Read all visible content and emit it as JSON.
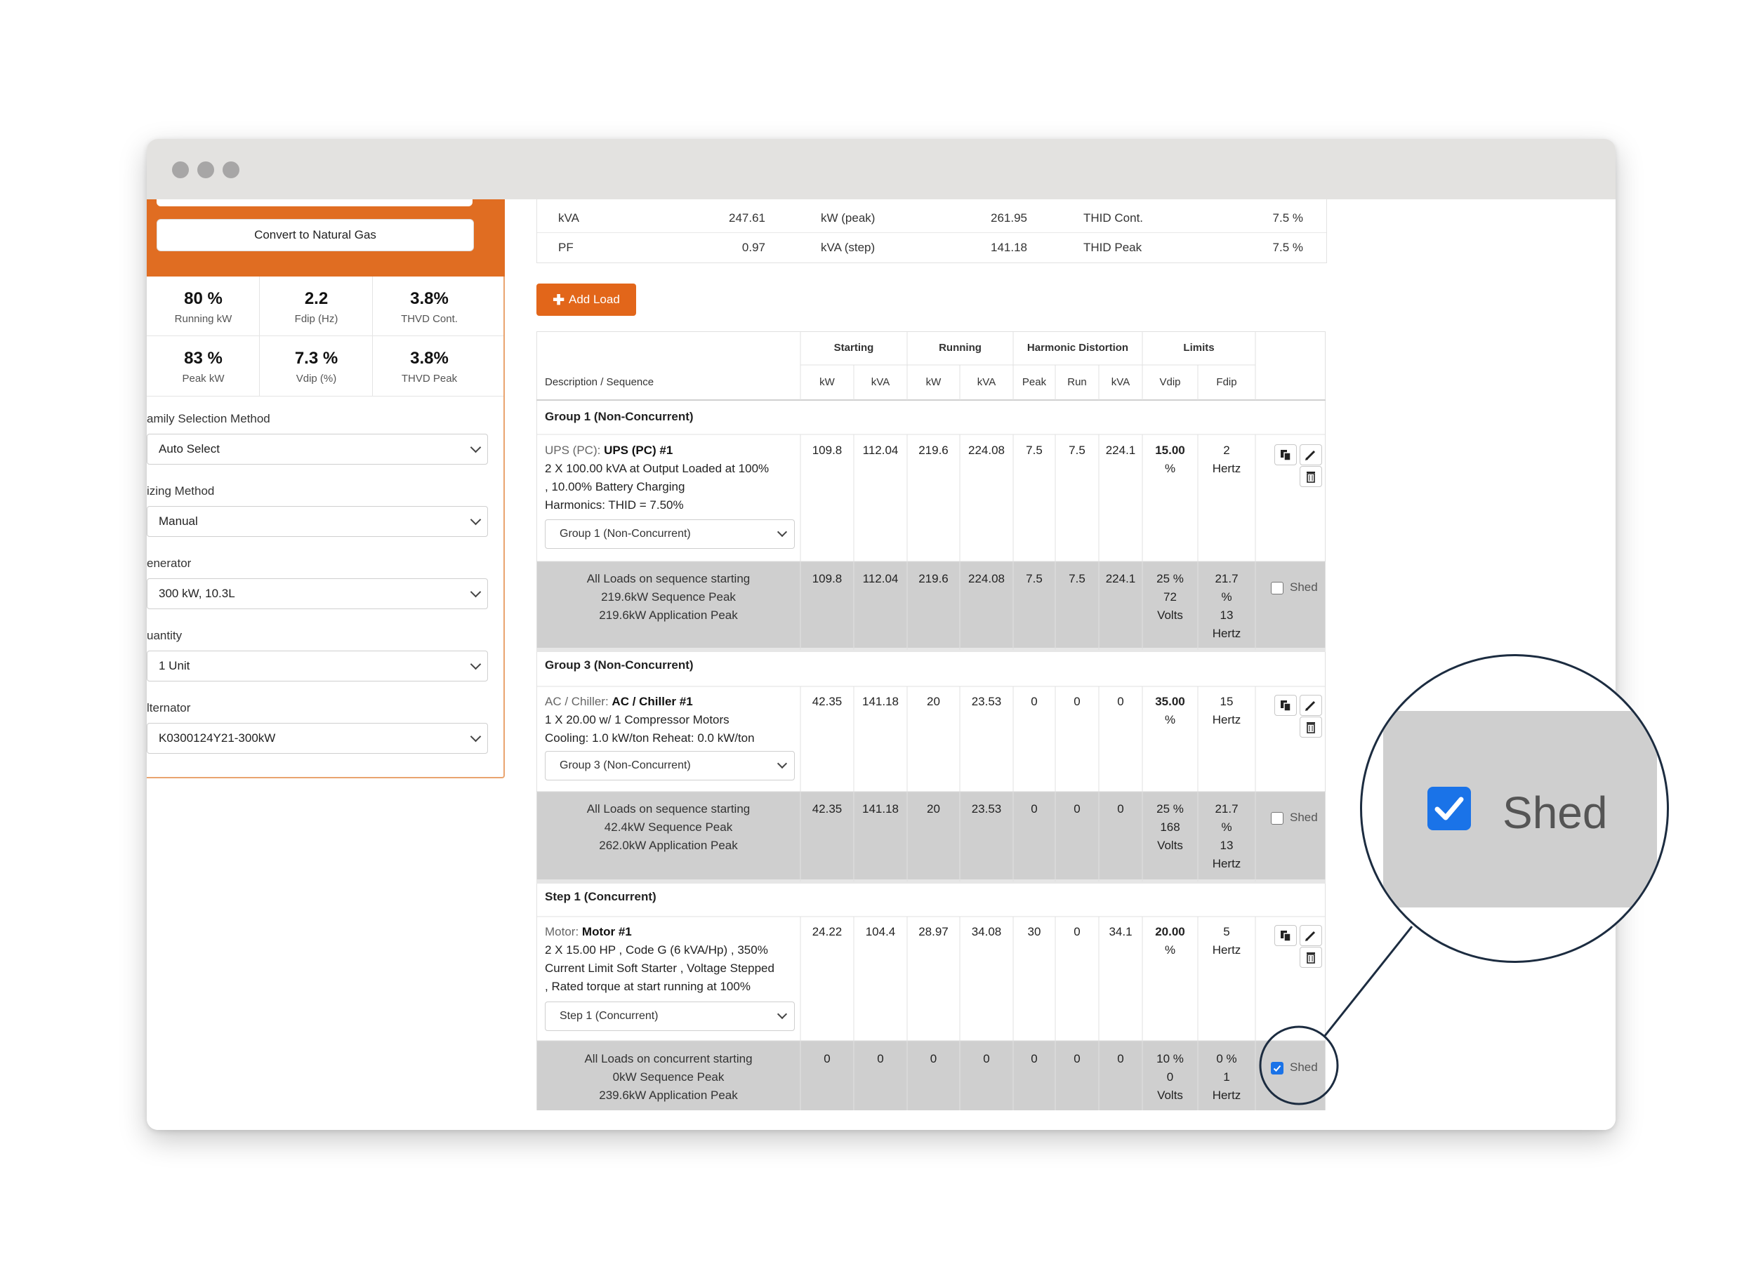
{
  "left_panel": {
    "convert_button": "Convert to Natural Gas",
    "stats": [
      {
        "value": "80 %",
        "label": "Running kW"
      },
      {
        "value": "2.2",
        "label": "Fdip (Hz)"
      },
      {
        "value": "3.8%",
        "label": "THVD Cont."
      },
      {
        "value": "83 %",
        "label": "Peak kW"
      },
      {
        "value": "7.3 %",
        "label": "Vdip (%)"
      },
      {
        "value": "3.8%",
        "label": "THVD Peak"
      }
    ],
    "fields": [
      {
        "label": "amily Selection Method",
        "value": "Auto Select"
      },
      {
        "label": "izing Method",
        "value": "Manual"
      },
      {
        "label": "enerator",
        "value": "300 kW, 10.3L"
      },
      {
        "label": "uantity",
        "value": "1 Unit"
      },
      {
        "label": "lternator",
        "value": "K0300124Y21-300kW"
      }
    ]
  },
  "summary": {
    "rows": [
      {
        "l1": "kVA",
        "v1": "247.61",
        "l2": "kW (peak)",
        "v2": "261.95",
        "l3": "THID Cont.",
        "v3": "7.5 %"
      },
      {
        "l1": "PF",
        "v1": "0.97",
        "l2": "kVA (step)",
        "v2": "141.18",
        "l3": "THID Peak",
        "v3": "7.5 %"
      }
    ]
  },
  "add_load_label": "Add Load",
  "table": {
    "header_groups": [
      "Starting",
      "Running",
      "Harmonic Distortion",
      "Limits"
    ],
    "description_header": "Description / Sequence",
    "columns": [
      "kW",
      "kVA",
      "kW",
      "kVA",
      "Peak",
      "Run",
      "kVA",
      "Vdip",
      "Fdip"
    ],
    "groups": [
      {
        "title": "Group 1 (Non-Concurrent)",
        "load": {
          "category": "UPS (PC): ",
          "name": "UPS (PC) #1",
          "lines": [
            "2 X 100.00 kVA at Output Loaded at 100%",
            ", 10.00% Battery Charging",
            "Harmonics: THID = 7.50%"
          ],
          "select": "Group 1 (Non-Concurrent)",
          "values": [
            "109.8",
            "112.04",
            "219.6",
            "224.08",
            "7.5",
            "7.5",
            "224.1"
          ],
          "vdip": [
            "15.00",
            "%"
          ],
          "fdip": [
            "2",
            "Hertz"
          ]
        },
        "summary": {
          "lines": [
            "All Loads on sequence starting",
            "219.6kW Sequence Peak",
            "219.6kW Application Peak"
          ],
          "values": [
            "109.8",
            "112.04",
            "219.6",
            "224.08",
            "7.5",
            "7.5",
            "224.1"
          ],
          "vdip": [
            "25 %",
            "72",
            "Volts"
          ],
          "fdip": [
            "21.7",
            "%",
            "13",
            "Hertz"
          ],
          "shed_label": "Shed",
          "shed_checked": false
        }
      },
      {
        "title": "Group 3 (Non-Concurrent)",
        "load": {
          "category": "AC / Chiller: ",
          "name": "AC / Chiller #1",
          "lines": [
            "1 X 20.00 w/ 1 Compressor Motors",
            "Cooling: 1.0 kW/ton Reheat: 0.0 kW/ton"
          ],
          "select": "Group 3 (Non-Concurrent)",
          "values": [
            "42.35",
            "141.18",
            "20",
            "23.53",
            "0",
            "0",
            "0"
          ],
          "vdip": [
            "35.00",
            "%"
          ],
          "fdip": [
            "15",
            "Hertz"
          ]
        },
        "summary": {
          "lines": [
            "All Loads on sequence starting",
            "42.4kW Sequence Peak",
            "262.0kW Application Peak"
          ],
          "values": [
            "42.35",
            "141.18",
            "20",
            "23.53",
            "0",
            "0",
            "0"
          ],
          "vdip": [
            "25 %",
            "168",
            "Volts"
          ],
          "fdip": [
            "21.7",
            "%",
            "13",
            "Hertz"
          ],
          "shed_label": "Shed",
          "shed_checked": false
        }
      },
      {
        "title": "Step 1 (Concurrent)",
        "load": {
          "category": "Motor: ",
          "name": "Motor #1",
          "lines": [
            "2 X 15.00 HP , Code G (6 kVA/Hp) , 350%",
            "Current Limit Soft Starter , Voltage Stepped",
            ", Rated torque at start running at 100%"
          ],
          "select": "Step 1 (Concurrent)",
          "values": [
            "24.22",
            "104.4",
            "28.97",
            "34.08",
            "30",
            "0",
            "34.1"
          ],
          "vdip": [
            "20.00",
            "%"
          ],
          "fdip": [
            "5",
            "Hertz"
          ]
        },
        "summary": {
          "lines": [
            "All Loads on concurrent starting",
            "0kW Sequence Peak",
            "239.6kW Application Peak"
          ],
          "values": [
            "0",
            "0",
            "0",
            "0",
            "0",
            "0",
            "0"
          ],
          "vdip": [
            "10 %",
            "0",
            "Volts"
          ],
          "fdip": [
            "0 %",
            "1",
            "Hertz"
          ],
          "shed_label": "Shed",
          "shed_checked": true
        }
      }
    ]
  },
  "zoom_callout": {
    "label": "Shed",
    "checked": true
  },
  "icons": [
    "copy-icon",
    "pencil-icon",
    "trash-icon",
    "plus-icon",
    "chevron-down-icon",
    "checkmark-icon"
  ],
  "colors": {
    "orange": "#e06d22",
    "button_orange": "#e2661a",
    "row_gray": "#cfcfcf",
    "checkbox_blue": "#1a73e8"
  }
}
